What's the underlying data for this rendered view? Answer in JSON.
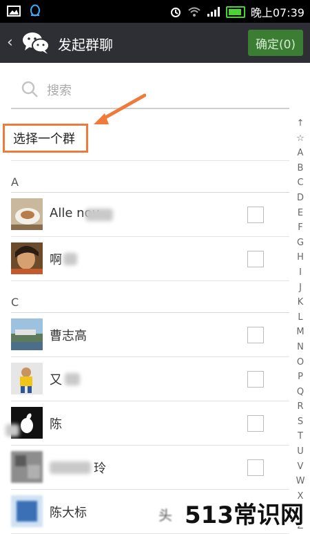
{
  "status_bar": {
    "time": "晚上07:39"
  },
  "header": {
    "back_label": "‹",
    "title": "发起群聊",
    "confirm_label": "确定(0)"
  },
  "search": {
    "placeholder": "搜索"
  },
  "select_group_label": "选择一个群",
  "sections": [
    {
      "letter": "A",
      "contacts": [
        {
          "name": "Alle   nou",
          "checked": false
        },
        {
          "name": "啊",
          "checked": false
        }
      ]
    },
    {
      "letter": "C",
      "contacts": [
        {
          "name": "曹志高",
          "checked": false
        },
        {
          "name": "又",
          "checked": false
        },
        {
          "name": "陈",
          "checked": false
        },
        {
          "name": "玲",
          "checked": false
        },
        {
          "name": "陈大标",
          "checked": false
        }
      ]
    }
  ],
  "index_letters": [
    "↑",
    "☆",
    "A",
    "B",
    "C",
    "D",
    "E",
    "F",
    "G",
    "H",
    "I",
    "J",
    "K",
    "L",
    "M",
    "N",
    "O",
    "P",
    "Q",
    "R",
    "S",
    "T",
    "U",
    "V",
    "W",
    "X",
    "Y",
    "Z"
  ],
  "watermark": "513常识网",
  "accent_color": "#f07a3a",
  "confirm_color": "#3a7d33"
}
